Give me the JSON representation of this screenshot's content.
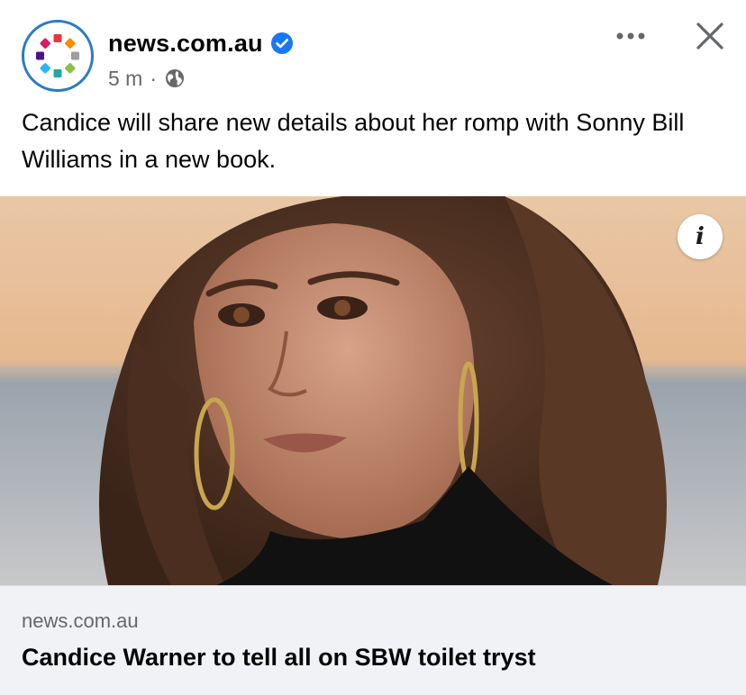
{
  "post": {
    "page_name": "news.com.au",
    "verified_icon": "verified-badge-icon",
    "time_ago": "5 m",
    "separator": "·",
    "audience_icon": "globe-icon",
    "caption": "Candice will share new details about her romp with Sonny Bill Williams in a new book.",
    "more_icon": "more-options-icon",
    "close_icon": "close-icon"
  },
  "media": {
    "image_alt": "Portrait of a woman with long brown hair and gold hoop earrings against an ocean sunset",
    "info_icon": "i"
  },
  "link_preview": {
    "domain": "news.com.au",
    "title": "Candice Warner to tell all on SBW toilet tryst"
  },
  "colors": {
    "brand_ring": "#2b7bc6",
    "verified_blue": "#1877f2",
    "secondary_text": "#65676b",
    "preview_bg": "#f0f2f5"
  }
}
